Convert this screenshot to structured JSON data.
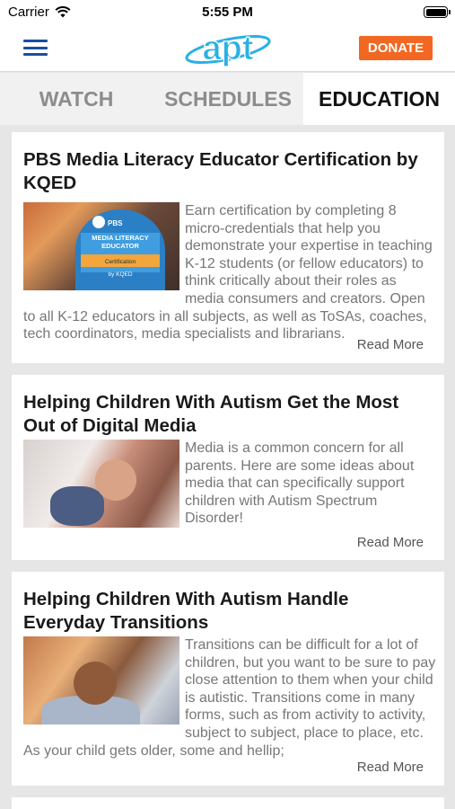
{
  "status_bar": {
    "carrier": "Carrier",
    "time": "5:55 PM"
  },
  "header": {
    "logo_text": "apt",
    "donate_label": "DONATE"
  },
  "tabs": [
    {
      "label": "WATCH",
      "active": false
    },
    {
      "label": "SCHEDULES",
      "active": false
    },
    {
      "label": "EDUCATION",
      "active": true
    }
  ],
  "articles": [
    {
      "title": "PBS Media Literacy Educator Certification by KQED",
      "thumb_badge": {
        "brand": "PBS",
        "line1": "MEDIA LITERACY",
        "line2": "EDUCATOR",
        "line3": "Certification",
        "line4": "by KQED"
      },
      "summary": "Earn certification by completing 8 micro-credentials that help you demonstrate your expertise in teaching K-12 students (or fellow educators) to think critically about their roles as media consumers and creators. Open to all K-12 educators in all subjects, as well as ToSAs, coaches, tech coordinators, media specialists and librarians.",
      "read_more": "Read More"
    },
    {
      "title": "Helping Children With Autism Get the Most Out of Digital Media",
      "summary": "Media is a common concern for all parents. Here are some ideas about media that can specifically support children with Autism Spectrum Disorder!",
      "read_more": "Read More"
    },
    {
      "title": "Helping Children With Autism Handle Everyday Transitions",
      "summary": "Transitions can be difficult for a lot of children, but you want to be sure to pay close attention to them when your child is autistic. Transitions come in many forms, such as from activity to activity, subject to subject, place to place, etc. As your child gets older, some and hellip;",
      "read_more": "Read More"
    }
  ],
  "colors": {
    "brand_blue": "#1a4f9c",
    "logo_cyan": "#2ab0e6",
    "donate_orange": "#f26722",
    "background": "#e6e6e6"
  }
}
